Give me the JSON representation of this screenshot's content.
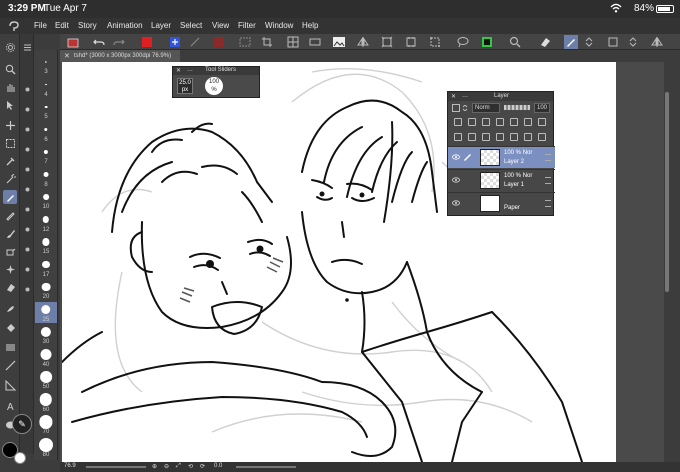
{
  "status_bar": {
    "time": "3:29 PM",
    "date": "Tue Apr 7",
    "battery": "84%",
    "battery_level": 0.84
  },
  "menu": {
    "items": [
      "File",
      "Edit",
      "Story",
      "Animation",
      "Layer",
      "Select",
      "View",
      "Filter",
      "Window",
      "Help"
    ]
  },
  "document": {
    "tab_title": "tshd* (3000 x 3000px 300dpi 76.9%)"
  },
  "brush_sizes": [
    "3",
    "4",
    "5",
    "6",
    "7",
    "8",
    "10",
    "12",
    "15",
    "17",
    "20",
    "25",
    "30",
    "40",
    "50",
    "60",
    "70",
    "80"
  ],
  "active_brush_size": "25",
  "tool_sliders": {
    "title": "Tool Sliders",
    "size_value": "25.0",
    "size_unit": "px",
    "opacity_value": "100",
    "opacity_unit": "%"
  },
  "layer_panel": {
    "title": "Layer",
    "blend_mode": "Norm",
    "opacity": "100",
    "layers": [
      {
        "opacity": "100 %",
        "blend": "Nor",
        "name": "Layer 2",
        "selected": true
      },
      {
        "opacity": "100 %",
        "blend": "Nor",
        "name": "Layer 1",
        "selected": false
      },
      {
        "opacity": "",
        "blend": "",
        "name": "Paper",
        "selected": false
      }
    ]
  },
  "bottom_bar": {
    "zoom": "76.9",
    "rotation": "0.0"
  },
  "colors": {
    "main": "#000000",
    "sub": "#ffffff",
    "accent": "#7b8fc0",
    "red_swatch": "#e02020"
  }
}
